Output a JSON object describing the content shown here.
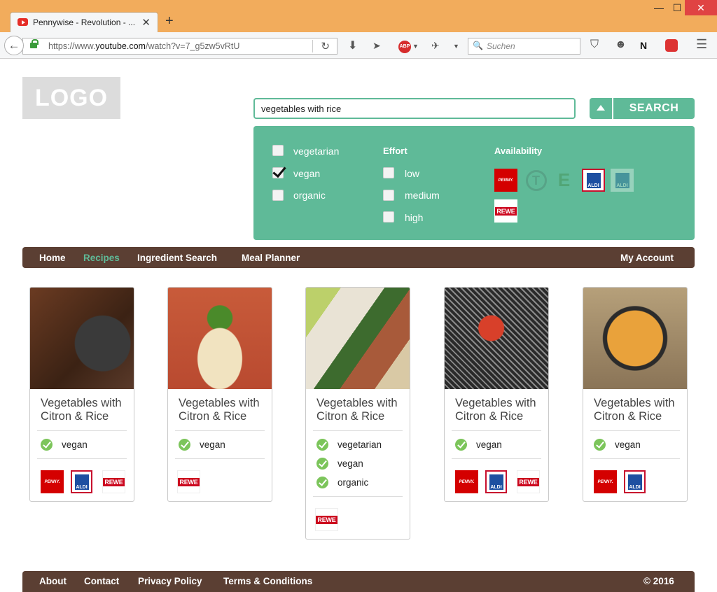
{
  "browser": {
    "tab_title": "Pennywise - Revolution - ...",
    "url_prefix": "https://www.",
    "url_domain": "youtube.com",
    "url_path": "/watch?v=7_g5zw5vRtU",
    "search_placeholder": "Suchen",
    "abp_label": "ABP"
  },
  "page": {
    "logo": "LOGO",
    "search_value": "vegetables with rice",
    "search_button": "SEARCH"
  },
  "filters": {
    "diet": [
      {
        "label": "vegetarian",
        "checked": false
      },
      {
        "label": "vegan",
        "checked": true
      },
      {
        "label": "organic",
        "checked": false
      }
    ],
    "effort_heading": "Effort",
    "effort": [
      {
        "label": "low",
        "checked": false
      },
      {
        "label": "medium",
        "checked": false
      },
      {
        "label": "high",
        "checked": false
      }
    ],
    "availability_heading": "Availability",
    "stores": [
      "PENNY.",
      "T",
      "E",
      "ALDI",
      "ALDI",
      "REWE"
    ]
  },
  "nav": {
    "items": [
      "Home",
      "Recipes",
      "Ingredient Search",
      "Meal Planner"
    ],
    "active": "Recipes",
    "account": "My Account"
  },
  "recipes": [
    {
      "title": "Vegetables with Citron & Rice",
      "tags": [
        "vegan"
      ],
      "stores": [
        "PENNY.",
        "ALDI",
        "REWE"
      ]
    },
    {
      "title": "Vegetables with Citron & Rice",
      "tags": [
        "vegan"
      ],
      "stores": [
        "REWE"
      ]
    },
    {
      "title": "Vegetables with Citron & Rice",
      "tags": [
        "vegetarian",
        "vegan",
        "organic"
      ],
      "stores": [
        "REWE"
      ]
    },
    {
      "title": "Vegetables with Citron & Rice",
      "tags": [
        "vegan"
      ],
      "stores": [
        "PENNY.",
        "ALDI",
        "REWE"
      ]
    },
    {
      "title": "Vegetables with Citron & Rice",
      "tags": [
        "vegan"
      ],
      "stores": [
        "PENNY.",
        "ALDI"
      ]
    }
  ],
  "footer": {
    "links": [
      "About",
      "Contact",
      "Privacy Policy",
      "Terms & Conditions"
    ],
    "copyright": "© 2016"
  },
  "colors": {
    "accent": "#5fba98",
    "nav_bg": "#5b3f33",
    "titlebar": "#f2ac5c"
  }
}
